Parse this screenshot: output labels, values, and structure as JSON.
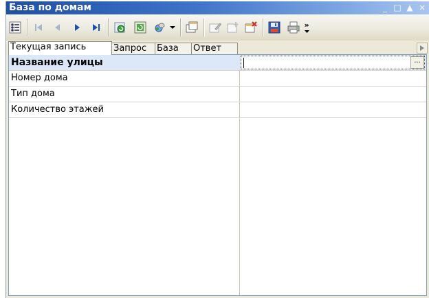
{
  "window": {
    "title": "База по домам",
    "controls": [
      "_",
      "□",
      "▲",
      "×"
    ]
  },
  "toolbar": {
    "buttons": [
      {
        "name": "grid-view-icon"
      },
      {
        "name": "first-record-icon"
      },
      {
        "name": "prev-record-icon"
      },
      {
        "name": "next-record-icon"
      },
      {
        "name": "last-record-icon"
      },
      {
        "name": "refresh-icon"
      },
      {
        "name": "reload-icon"
      },
      {
        "name": "search-icon"
      },
      {
        "name": "dropdown-arrow-icon"
      },
      {
        "name": "new-record-icon"
      },
      {
        "name": "edit-record-icon"
      },
      {
        "name": "add-record-icon"
      },
      {
        "name": "delete-record-icon"
      },
      {
        "name": "save-icon"
      },
      {
        "name": "print-icon"
      }
    ],
    "overflow": "»"
  },
  "tabs": [
    {
      "label": "Текущая запись"
    },
    {
      "label": "Запрос"
    },
    {
      "label": "База"
    },
    {
      "label": "Ответ"
    }
  ],
  "grid": {
    "rows": [
      {
        "label": "Название улицы",
        "value": ""
      },
      {
        "label": "Номер дома",
        "value": ""
      },
      {
        "label": "Тип дома",
        "value": ""
      },
      {
        "label": "Количество этажей",
        "value": ""
      }
    ],
    "ellipsis": "..."
  },
  "colors": {
    "title_bar": "#1e50a8",
    "header_row": "#dce8f7",
    "window_bg": "#ece9d8"
  }
}
